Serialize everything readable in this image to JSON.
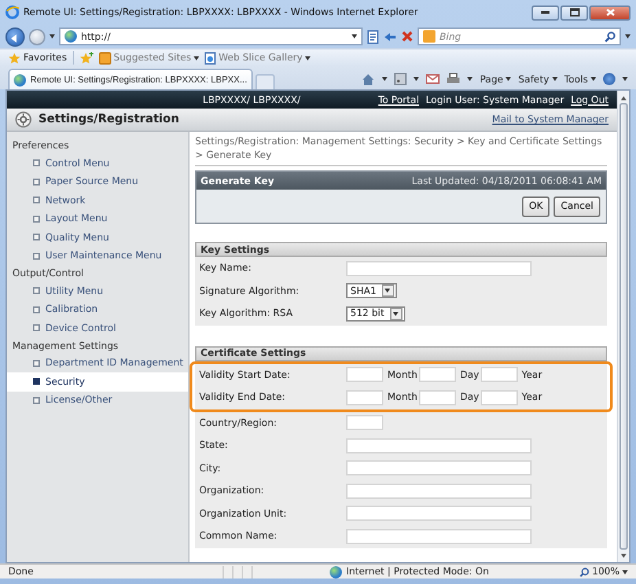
{
  "window": {
    "title": "Remote UI: Settings/Registration: LBPXXXX: LBPXXXX - Windows Internet Explorer"
  },
  "address_bar": {
    "value": "http://"
  },
  "search": {
    "placeholder": "Bing"
  },
  "favorites_bar": {
    "label": "Favorites",
    "items": [
      {
        "label": "Suggested Sites"
      },
      {
        "label": "Web Slice Gallery"
      }
    ]
  },
  "tabs": [
    {
      "label": "Remote UI: Settings/Registration: LBPXXXX: LBPXX...",
      "selected": true
    }
  ],
  "command_bar": [
    {
      "label": "Page"
    },
    {
      "label": "Safety"
    },
    {
      "label": "Tools"
    }
  ],
  "page": {
    "device": "LBPXXXX/ LBPXXXX/",
    "portal_link": "To Portal",
    "login": "Login User: System Manager",
    "logout_link": "Log Out",
    "title": "Settings/Registration",
    "mail_link": "Mail to System Manager"
  },
  "sidebar": [
    {
      "title": "Preferences",
      "items": [
        {
          "label": "Control Menu",
          "selected": false
        },
        {
          "label": "Paper Source Menu",
          "selected": false
        },
        {
          "label": "Network",
          "selected": false
        },
        {
          "label": "Layout Menu",
          "selected": false
        },
        {
          "label": "Quality Menu",
          "selected": false
        },
        {
          "label": "User Maintenance Menu",
          "selected": false
        }
      ]
    },
    {
      "title": "Output/Control",
      "items": [
        {
          "label": "Utility Menu",
          "selected": false
        },
        {
          "label": "Calibration",
          "selected": false
        },
        {
          "label": "Device Control",
          "selected": false
        }
      ]
    },
    {
      "title": "Management Settings",
      "items": [
        {
          "label": "Department ID Management",
          "selected": false
        },
        {
          "label": "Security",
          "selected": true
        },
        {
          "label": "License/Other",
          "selected": false
        }
      ]
    }
  ],
  "breadcrumb": "Settings/Registration: Management Settings: Security > Key and Certificate Settings > Generate Key",
  "panel": {
    "title": "Generate Key",
    "updated": "Last Updated: 04/18/2011 06:08:41 AM",
    "buttons": [
      "OK",
      "Cancel"
    ]
  },
  "sections": [
    {
      "title": "Key Settings",
      "rows": [
        {
          "kind": "text",
          "label": "Key Name:",
          "highlighted": false
        },
        {
          "kind": "select",
          "label": "Signature Algorithm:",
          "value": "SHA1",
          "highlighted": false
        },
        {
          "kind": "select",
          "label": "Key Algorithm: RSA",
          "value": "512 bit",
          "highlighted": false
        }
      ]
    },
    {
      "title": "Certificate Settings",
      "rows": [
        {
          "kind": "date",
          "label": "Validity Start Date:",
          "parts": [
            "Month",
            "Day",
            "Year"
          ],
          "highlighted": true
        },
        {
          "kind": "date",
          "label": "Validity End Date:",
          "parts": [
            "Month",
            "Day",
            "Year"
          ],
          "highlighted": true
        },
        {
          "kind": "short",
          "label": "Country/Region:",
          "highlighted": false
        },
        {
          "kind": "text",
          "label": "State:",
          "highlighted": false
        },
        {
          "kind": "text",
          "label": "City:",
          "highlighted": false
        },
        {
          "kind": "text",
          "label": "Organization:",
          "highlighted": false
        },
        {
          "kind": "text",
          "label": "Organization Unit:",
          "highlighted": false
        },
        {
          "kind": "text",
          "label": "Common Name:",
          "highlighted": false
        }
      ]
    }
  ],
  "status_bar": {
    "text": "Done",
    "zone": "Internet | Protected Mode: On",
    "zoom": "100%"
  }
}
